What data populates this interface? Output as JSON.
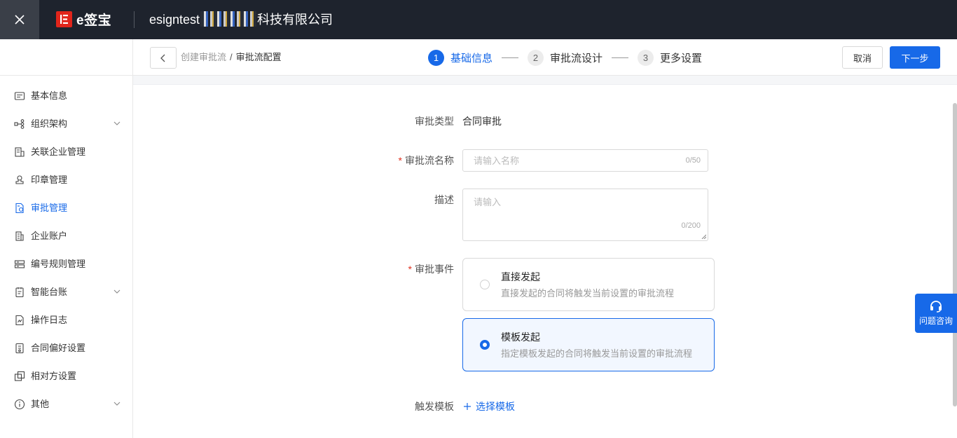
{
  "topbar": {
    "logo_text": "e签宝",
    "org_prefix": "esigntest",
    "org_suffix": "科技有限公司",
    "close_icon": "close-icon",
    "bg_color": "#1e232d"
  },
  "subheader": {
    "breadcrumb": {
      "parent": "创建审批流",
      "separator": "/",
      "current": "审批流配置"
    },
    "steps": [
      {
        "num": "1",
        "label": "基础信息",
        "active": true
      },
      {
        "num": "2",
        "label": "审批流设计",
        "active": false
      },
      {
        "num": "3",
        "label": "更多设置",
        "active": false
      }
    ],
    "cancel_label": "取消",
    "next_label": "下一步",
    "accent_color": "#1769e8"
  },
  "sidebar": {
    "items": [
      {
        "label": "基本信息",
        "icon": "profile-card-icon",
        "expandable": false,
        "active": false
      },
      {
        "label": "组织架构",
        "icon": "org-tree-icon",
        "expandable": true,
        "active": false
      },
      {
        "label": "关联企业管理",
        "icon": "building-link-icon",
        "expandable": false,
        "active": false
      },
      {
        "label": "印章管理",
        "icon": "seal-icon",
        "expandable": false,
        "active": false
      },
      {
        "label": "审批管理",
        "icon": "approval-doc-icon",
        "expandable": false,
        "active": true
      },
      {
        "label": "企业账户",
        "icon": "enterprise-icon",
        "expandable": false,
        "active": false
      },
      {
        "label": "编号规则管理",
        "icon": "number-rule-icon",
        "expandable": false,
        "active": false
      },
      {
        "label": "智能台账",
        "icon": "ledger-icon",
        "expandable": true,
        "active": false
      },
      {
        "label": "操作日志",
        "icon": "log-file-icon",
        "expandable": false,
        "active": false
      },
      {
        "label": "合同偏好设置",
        "icon": "contract-pref-icon",
        "expandable": false,
        "active": false
      },
      {
        "label": "相对方设置",
        "icon": "counterparty-icon",
        "expandable": false,
        "active": false
      },
      {
        "label": "其他",
        "icon": "info-circle-icon",
        "expandable": true,
        "active": false
      }
    ]
  },
  "form": {
    "type_label": "审批类型",
    "type_value": "合同审批",
    "name_label": "审批流名称",
    "name_placeholder": "请输入名称",
    "name_value": "",
    "name_counter": "0/50",
    "desc_label": "描述",
    "desc_placeholder": "请输入",
    "desc_value": "",
    "desc_counter": "0/200",
    "event_label": "审批事件",
    "events": [
      {
        "title": "直接发起",
        "desc": "直接发起的合同将触发当前设置的审批流程",
        "selected": false
      },
      {
        "title": "模板发起",
        "desc": "指定模板发起的合同将触发当前设置的审批流程",
        "selected": true
      }
    ],
    "template_label": "触发模板",
    "template_action": "选择模板"
  },
  "help": {
    "label": "问题咨询",
    "icon": "headset-icon"
  }
}
